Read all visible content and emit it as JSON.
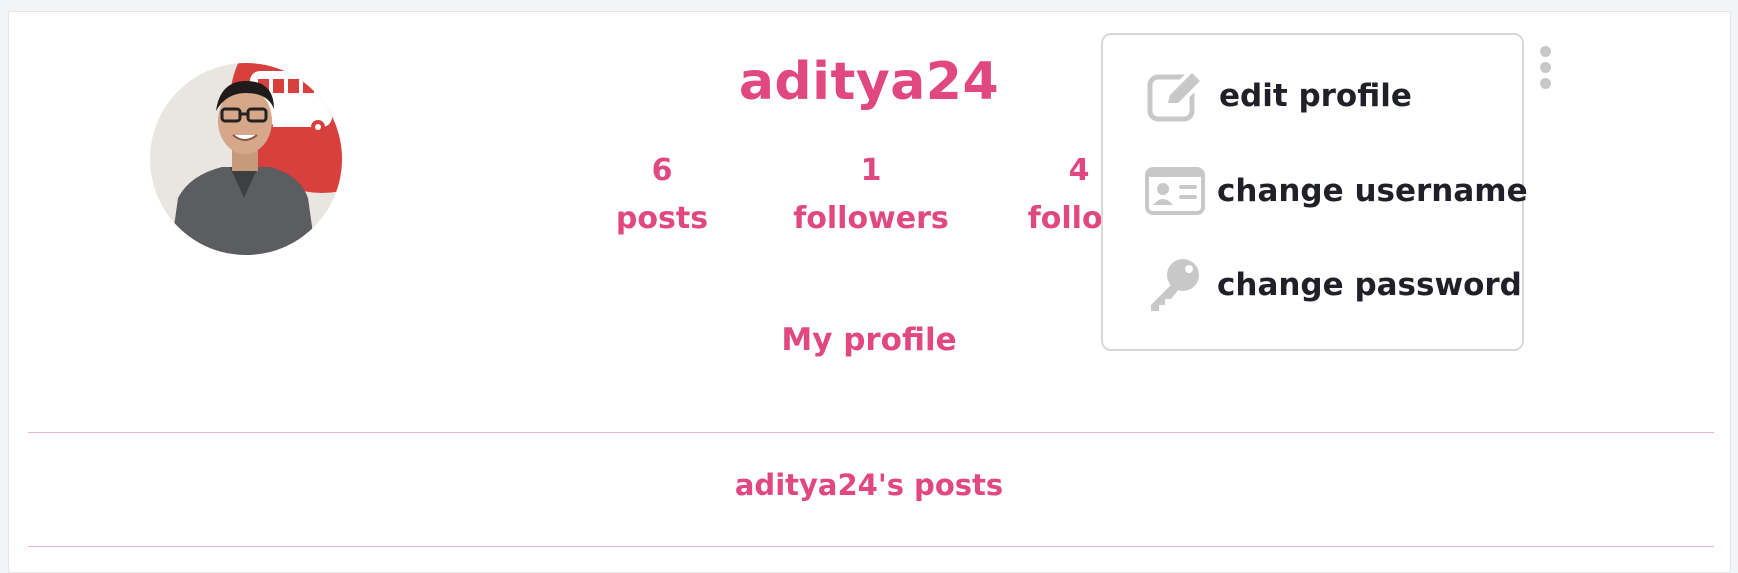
{
  "profile": {
    "username": "aditya24",
    "avatar_alt": "profile photo",
    "my_profile_label": "My profile",
    "posts_heading": "aditya24's posts"
  },
  "stats": [
    {
      "value": "6",
      "label": "posts"
    },
    {
      "value": "1",
      "label": "followers"
    },
    {
      "value": "4",
      "label": "follow"
    }
  ],
  "menu": {
    "items": [
      {
        "label": "edit profile",
        "icon": "edit-icon"
      },
      {
        "label": "change username",
        "icon": "id-card-icon"
      },
      {
        "label": "change password",
        "icon": "key-icon"
      }
    ]
  },
  "colors": {
    "accent": "#e0487f",
    "menu_text": "#1f2028",
    "icon_gray": "#c8c8c8",
    "divider": "#f0b7c8"
  }
}
